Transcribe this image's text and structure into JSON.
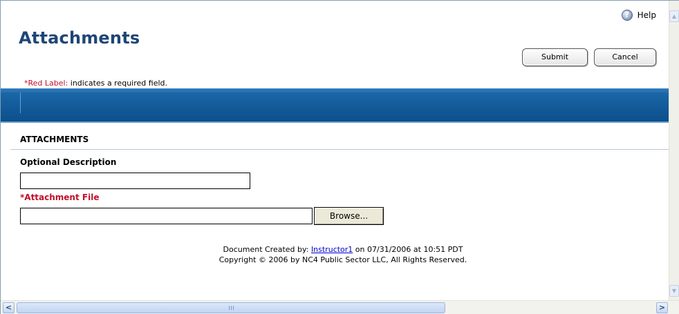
{
  "help": {
    "label": "Help",
    "icon": "help-icon"
  },
  "page": {
    "title": "Attachments"
  },
  "toolbar": {
    "submit_label": "Submit",
    "cancel_label": "Cancel"
  },
  "required_note": {
    "prefix": "*Red Label:",
    "text": " indicates a required field."
  },
  "section": {
    "header": "ATTACHMENTS"
  },
  "form": {
    "description_label": "Optional Description",
    "description_value": "",
    "file_label": "*Attachment File",
    "file_value": "",
    "browse_label": "Browse..."
  },
  "footer": {
    "created_prefix": "Document Created by: ",
    "created_by": "Instructor1",
    "created_suffix": " on 07/31/2006 at 10:51 PDT",
    "copyright": "Copyright © 2006 by NC4 Public Sector LLC, All Rights Reserved."
  },
  "colors": {
    "title": "#1e4676",
    "required": "#c0102a",
    "bar": "#15609f",
    "link": "#0000cc"
  }
}
